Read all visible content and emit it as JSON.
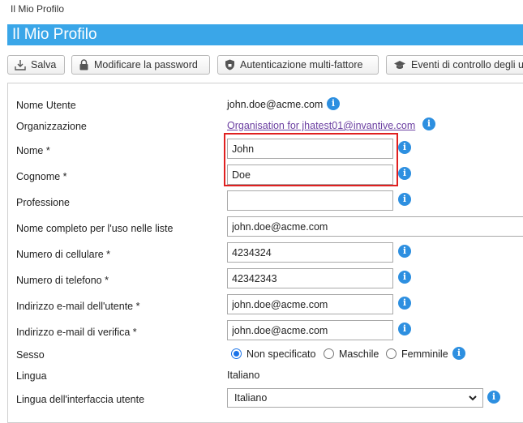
{
  "breadcrumb": "Il Mio Profilo",
  "page_title": "Il Mio Profilo",
  "toolbar": {
    "save": "Salva",
    "change_password": "Modificare la password",
    "mfa": "Autenticazione multi-fattore",
    "audit": "Eventi di controllo degli u"
  },
  "form": {
    "username": {
      "label": "Nome Utente",
      "value": "john.doe@acme.com"
    },
    "organization": {
      "label": "Organizzazione",
      "value": "Organisation for jhatest01@invantive.com"
    },
    "first_name": {
      "label": "Nome *",
      "value": "John"
    },
    "last_name": {
      "label": "Cognome *",
      "value": "Doe"
    },
    "profession": {
      "label": "Professione",
      "value": ""
    },
    "full_name": {
      "label": "Nome completo per l'uso nelle liste",
      "value": "john.doe@acme.com"
    },
    "mobile": {
      "label": "Numero di cellulare *",
      "value": "4234324"
    },
    "phone": {
      "label": "Numero di telefono *",
      "value": "42342343"
    },
    "email": {
      "label": "Indirizzo e-mail dell'utente *",
      "value": "john.doe@acme.com"
    },
    "verify_email": {
      "label": "Indirizzo e-mail di verifica *",
      "value": "john.doe@acme.com"
    },
    "gender": {
      "label": "Sesso",
      "options": [
        "Non specificato",
        "Maschile",
        "Femminile"
      ],
      "selected": "Non specificato"
    },
    "language": {
      "label": "Lingua",
      "value": "Italiano"
    },
    "ui_language": {
      "label": "Lingua dell'interfaccia utente",
      "value": "Italiano"
    }
  },
  "colors": {
    "title_bar": "#3aa6e8",
    "info_icon": "#2d8fe0",
    "highlight": "#e02020",
    "link": "#6a3ea1"
  }
}
